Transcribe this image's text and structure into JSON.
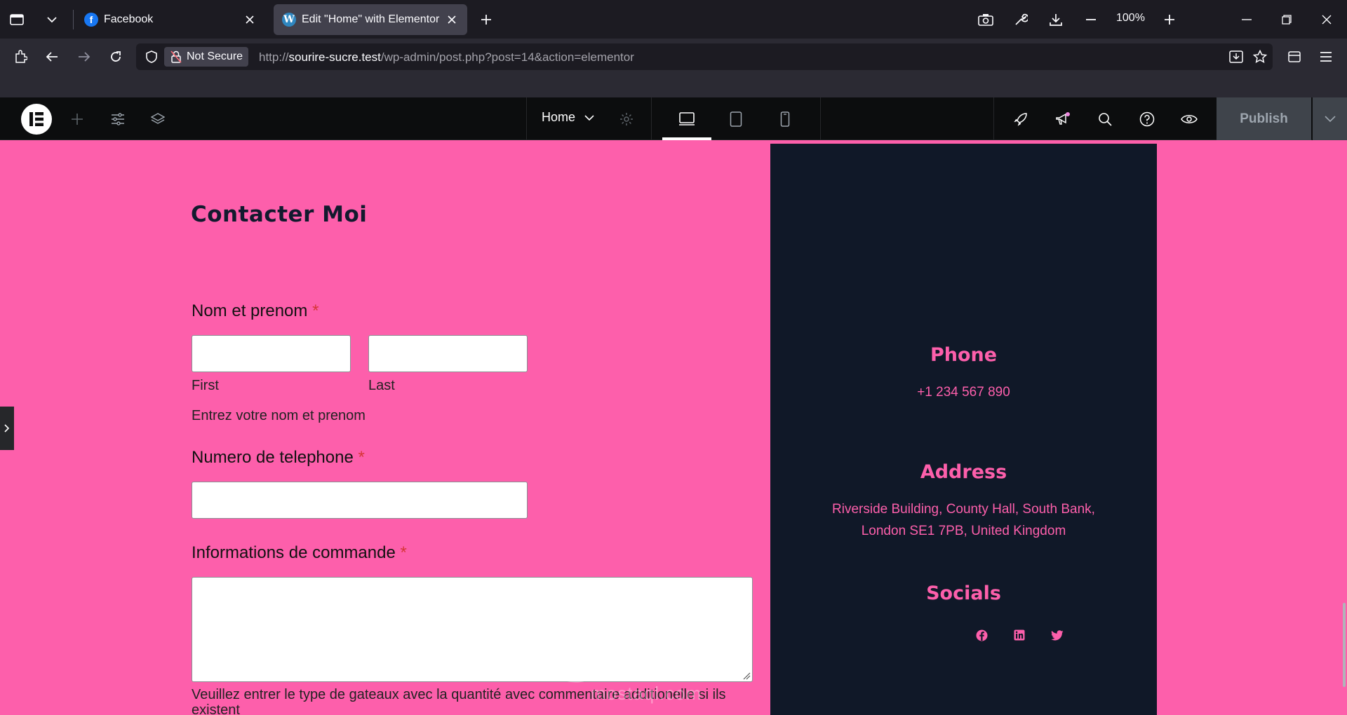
{
  "browser": {
    "tabs": [
      {
        "title": "Facebook",
        "active": false,
        "favicon": "facebook-icon"
      },
      {
        "title": "Edit \"Home\" with Elementor",
        "active": true,
        "favicon": "wordpress-icon"
      }
    ],
    "zoom": "100%",
    "security_label": "Not Secure",
    "url_prefix": "http://",
    "url_host": "sourire-sucre.test",
    "url_path": "/wp-admin/post.php?post=14&action=elementor"
  },
  "elementor": {
    "page_name": "Home",
    "publish_label": "Publish"
  },
  "form": {
    "title": "Contacter Moi",
    "name_label": "Nom et prenom",
    "required_mark": "*",
    "first_sublabel": "First",
    "last_sublabel": "Last",
    "name_description": "Entrez votre nom et prenom",
    "phone_label": "Numero de telephone",
    "order_label": "Informations de commande",
    "order_description": "Veuillez entrer le type de gateaux avec la quantité avec commentaire additionelle si ils existent"
  },
  "sidebar": {
    "phone_heading": "Phone",
    "phone_value": "+1 234 567 890",
    "address_heading": "Address",
    "address_line1": "Riverside Building, County Hall, South Bank,",
    "address_line2": "London SE1 7PB, United Kingdom",
    "socials_heading": "Socials",
    "socials": [
      "facebook-icon",
      "linkedin-icon",
      "twitter-icon"
    ]
  },
  "watermark": {
    "arabic": "مستقل",
    "latin": "mostaql.com"
  },
  "colors": {
    "canvas_bg": "#fd5fab",
    "sidebar_bg": "#101828",
    "accent": "#fd5fab",
    "title": "#121a2e"
  }
}
